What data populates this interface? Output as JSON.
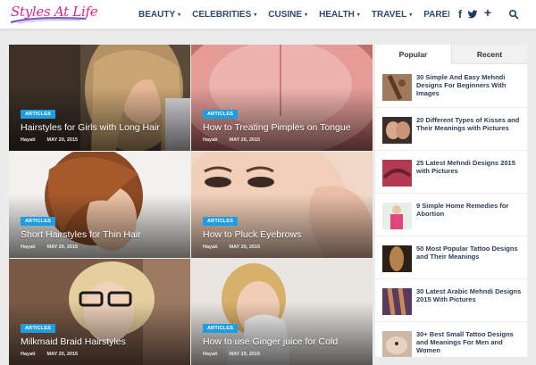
{
  "site": {
    "logo_text": "Styles At Life",
    "nav": [
      {
        "label": "BEAUTY",
        "caret": "▾"
      },
      {
        "label": "CELEBRITIES",
        "caret": "▾"
      },
      {
        "label": "CUSINE",
        "caret": "▾"
      },
      {
        "label": "HEALTH",
        "caret": "▾"
      },
      {
        "label": "TRAVEL",
        "caret": "▾"
      },
      {
        "label": "PARENTING",
        "caret": ""
      }
    ],
    "social": {
      "facebook": "f",
      "twitter": "t",
      "plus": "+"
    },
    "colors": {
      "nav_text": "#2d4a6e",
      "logo": "#e4258f",
      "badge": "#1e9ee0"
    }
  },
  "articles": [
    {
      "category": "ARTICLES",
      "title": "Hairstyles for Girls with Long Hair",
      "author": "Hayati",
      "date": "MAY 20, 2015"
    },
    {
      "category": "ARTICLES",
      "title": "How to Treating Pimples on Tongue",
      "author": "Hayati",
      "date": "MAY 20, 2015"
    },
    {
      "category": "ARTICLES",
      "title": "Short Hairstyles for Thin Hair",
      "author": "Hayati",
      "date": "MAY 20, 2015"
    },
    {
      "category": "ARTICLES",
      "title": "How to Pluck Eyebrows",
      "author": "Hayati",
      "date": "MAY 20, 2015"
    },
    {
      "category": "ARTICLES",
      "title": "Milkmaid Braid Hairstyles",
      "author": "Hayati",
      "date": "MAY 20, 2015"
    },
    {
      "category": "ARTICLES",
      "title": "How to use Ginger juice for Cold",
      "author": "Hayati",
      "date": "MAY 19, 2015"
    }
  ],
  "sidebar": {
    "tabs": {
      "popular": "Popular",
      "recent": "Recent"
    },
    "posts": [
      {
        "title": "30 Simple And Easy Mehndi Designs For Beginners With Images"
      },
      {
        "title": "20 Different Types of Kisses and Their Meanings with Pictures"
      },
      {
        "title": "25 Latest Mehndi Designs 2015 with Pictures"
      },
      {
        "title": "9 Simple Home Remedies for Abortion"
      },
      {
        "title": "50 Most Popular Tattoo Designs and Their Meanings"
      },
      {
        "title": "30 Latest Arabic Mehndi Designs 2015 With Pictures"
      },
      {
        "title": "30+ Best Small Tattoo Designs and Meanings For Men and Women"
      }
    ]
  }
}
